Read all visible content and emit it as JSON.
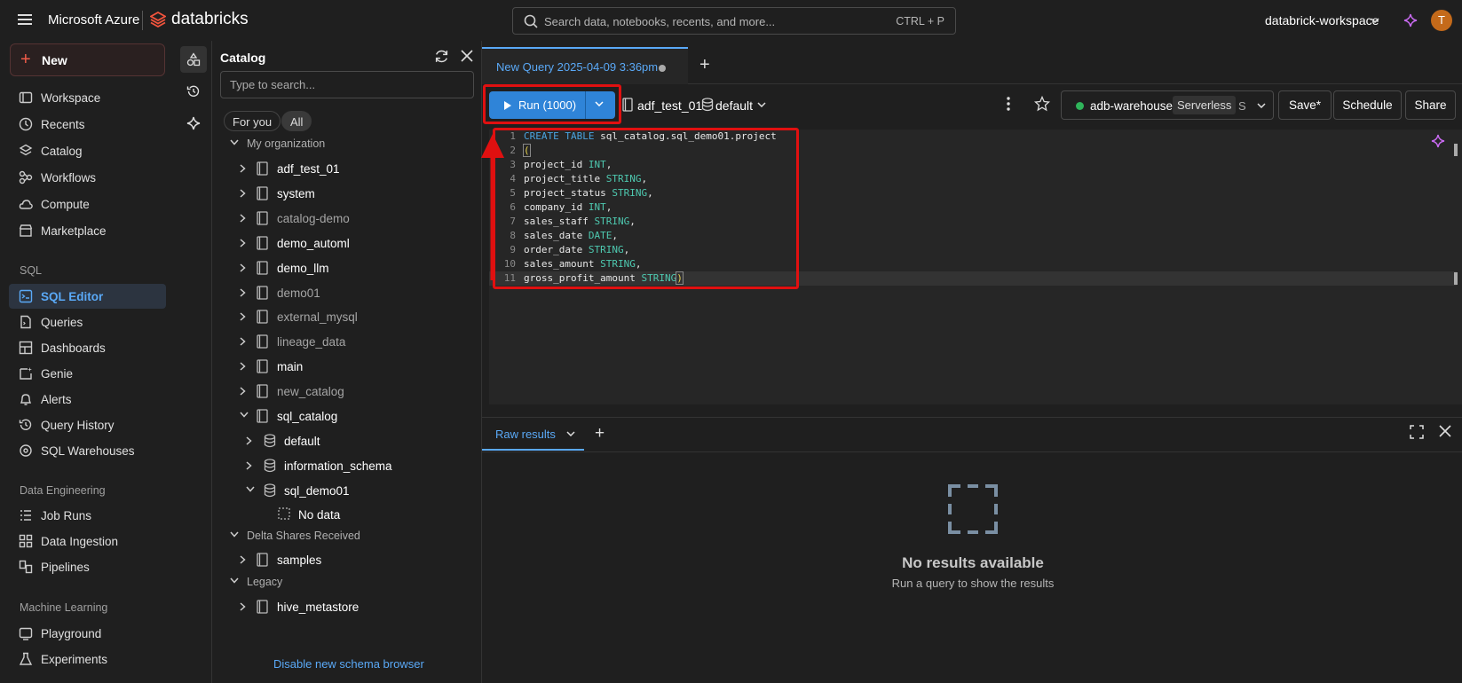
{
  "topbar": {
    "brand": "Microsoft Azure",
    "product": "databricks",
    "search_placeholder": "Search data, notebooks, recents, and more...",
    "search_shortcut": "CTRL + P",
    "workspace": "databrick-workspace",
    "avatar_initial": "T"
  },
  "nav": {
    "new_label": "New",
    "items": [
      {
        "label": "Workspace",
        "icon": "folder-icon"
      },
      {
        "label": "Recents",
        "icon": "clock-icon"
      },
      {
        "label": "Catalog",
        "icon": "catalog-icon"
      },
      {
        "label": "Workflows",
        "icon": "workflows-icon"
      },
      {
        "label": "Compute",
        "icon": "cloud-icon"
      },
      {
        "label": "Marketplace",
        "icon": "marketplace-icon"
      }
    ],
    "sql_section": "SQL",
    "sql_items": [
      {
        "label": "SQL Editor",
        "icon": "sql-editor-icon"
      },
      {
        "label": "Queries",
        "icon": "queries-icon"
      },
      {
        "label": "Dashboards",
        "icon": "dashboards-icon"
      },
      {
        "label": "Genie",
        "icon": "genie-icon"
      },
      {
        "label": "Alerts",
        "icon": "bell-icon"
      },
      {
        "label": "Query History",
        "icon": "history-icon"
      },
      {
        "label": "SQL Warehouses",
        "icon": "warehouse-icon"
      }
    ],
    "de_section": "Data Engineering",
    "de_items": [
      {
        "label": "Job Runs",
        "icon": "job-runs-icon"
      },
      {
        "label": "Data Ingestion",
        "icon": "ingestion-icon"
      },
      {
        "label": "Pipelines",
        "icon": "pipelines-icon"
      }
    ],
    "ml_section": "Machine Learning",
    "ml_items": [
      {
        "label": "Playground",
        "icon": "playground-icon"
      },
      {
        "label": "Experiments",
        "icon": "experiments-icon"
      }
    ]
  },
  "catalog": {
    "title": "Catalog",
    "search_placeholder": "Type to search...",
    "filter_for_you": "For you",
    "filter_all": "All",
    "my_org": "My organization",
    "tree": [
      {
        "label": "adf_test_01",
        "bright": true,
        "icon": "catalog-lock-icon"
      },
      {
        "label": "system",
        "bright": true,
        "icon": "catalog-gear-icon"
      },
      {
        "label": "catalog-demo",
        "bright": false,
        "icon": "catalog-icon"
      },
      {
        "label": "demo_automl",
        "bright": true,
        "icon": "catalog-icon"
      },
      {
        "label": "demo_llm",
        "bright": true,
        "icon": "catalog-icon"
      },
      {
        "label": "demo01",
        "bright": false,
        "icon": "catalog-icon"
      },
      {
        "label": "external_mysql",
        "bright": false,
        "icon": "catalog-icon"
      },
      {
        "label": "lineage_data",
        "bright": false,
        "icon": "catalog-icon"
      },
      {
        "label": "main",
        "bright": true,
        "icon": "catalog-icon"
      },
      {
        "label": "new_catalog",
        "bright": false,
        "icon": "catalog-icon"
      },
      {
        "label": "sql_catalog",
        "bright": true,
        "icon": "catalog-icon"
      }
    ],
    "schemas": [
      "default",
      "information_schema",
      "sql_demo01"
    ],
    "no_data": "No data",
    "delta_section": "Delta Shares Received",
    "samples": "samples",
    "legacy_section": "Legacy",
    "hive": "hive_metastore",
    "disable_link": "Disable new schema browser"
  },
  "editor": {
    "tab_title": "New Query 2025-04-09 3:36pm",
    "run_label": "Run (1000)",
    "catalog": "adf_test_01",
    "schema": "default",
    "warehouse": "adb-warehouse",
    "warehouse_type": "Serverless",
    "warehouse_size": "S",
    "save": "Save*",
    "schedule": "Schedule",
    "share": "Share",
    "code": [
      [
        [
          "kw",
          "CREATE TABLE "
        ],
        [
          "",
          "sql_catalog.sql_demo01.project"
        ]
      ],
      [
        [
          "paren",
          "("
        ]
      ],
      [
        [
          "",
          "project_id "
        ],
        [
          "ty",
          "INT"
        ],
        [
          "",
          ","
        ]
      ],
      [
        [
          "",
          "project_title "
        ],
        [
          "ty",
          "STRING"
        ],
        [
          "",
          ","
        ]
      ],
      [
        [
          "",
          "project_status "
        ],
        [
          "ty",
          "STRING"
        ],
        [
          "",
          ","
        ]
      ],
      [
        [
          "",
          "company_id "
        ],
        [
          "ty",
          "INT"
        ],
        [
          "",
          ","
        ]
      ],
      [
        [
          "",
          "sales_staff "
        ],
        [
          "ty",
          "STRING"
        ],
        [
          "",
          ","
        ]
      ],
      [
        [
          "",
          "sales_date "
        ],
        [
          "ty",
          "DATE"
        ],
        [
          "",
          ","
        ]
      ],
      [
        [
          "",
          "order_date "
        ],
        [
          "ty",
          "STRING"
        ],
        [
          "",
          ","
        ]
      ],
      [
        [
          "",
          "sales_amount "
        ],
        [
          "ty",
          "STRING"
        ],
        [
          "",
          ","
        ]
      ],
      [
        [
          "",
          "gross_profit_amount "
        ],
        [
          "ty",
          "STRING"
        ],
        [
          "paren",
          ")"
        ]
      ]
    ]
  },
  "results": {
    "tab": "Raw results",
    "empty_title": "No results available",
    "empty_sub": "Run a query to show the results"
  },
  "colors": {
    "accent": "#5aa9f7",
    "run": "#2f84d8",
    "annotation": "#e01010",
    "warehouse_ok": "#2fb45a"
  }
}
